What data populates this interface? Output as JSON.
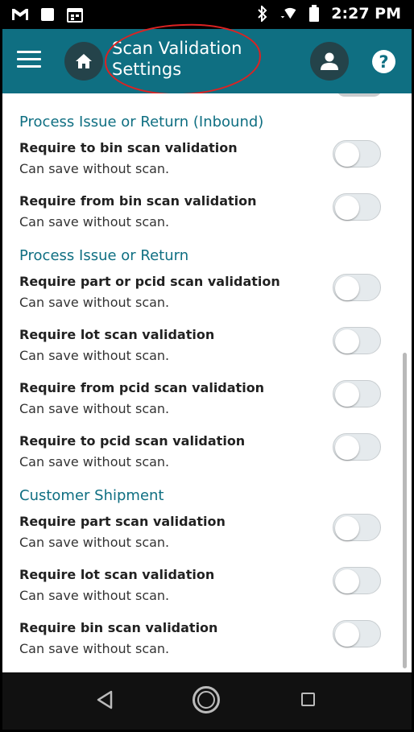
{
  "status_bar": {
    "time": "2:27 PM",
    "icons": [
      "gmail-icon",
      "notification-square-icon",
      "calendar-icon",
      "bluetooth-icon",
      "wifi-icon",
      "battery-icon"
    ]
  },
  "app_bar": {
    "title": "Scan Validation Settings",
    "menu_icon": "hamburger-menu-icon",
    "home_icon": "home-icon",
    "account_icon": "person-icon",
    "help_label": "?"
  },
  "colors": {
    "app_bar": "#0f6f82",
    "section_header": "#0f6f82",
    "annotation": "#dd2222"
  },
  "sections": [
    {
      "title": "Process Issue or Return (Inbound)",
      "settings": [
        {
          "label": "Require to bin scan validation",
          "description": "Can save without scan.",
          "enabled": false
        },
        {
          "label": "Require from bin scan validation",
          "description": "Can save without scan.",
          "enabled": false
        }
      ]
    },
    {
      "title": "Process Issue or Return",
      "settings": [
        {
          "label": "Require part or pcid scan validation",
          "description": "Can save without scan.",
          "enabled": false
        },
        {
          "label": "Require lot scan validation",
          "description": "Can save without scan.",
          "enabled": false
        },
        {
          "label": "Require from pcid scan validation",
          "description": "Can save without scan.",
          "enabled": false
        },
        {
          "label": "Require to pcid scan validation",
          "description": "Can save without scan.",
          "enabled": false
        }
      ]
    },
    {
      "title": "Customer Shipment",
      "settings": [
        {
          "label": "Require part scan validation",
          "description": "Can save without scan.",
          "enabled": false
        },
        {
          "label": "Require lot scan validation",
          "description": "Can save without scan.",
          "enabled": false
        },
        {
          "label": "Require bin scan validation",
          "description": "Can save without scan.",
          "enabled": false
        }
      ]
    }
  ],
  "nav_bar": {
    "icons": [
      "back-triangle-icon",
      "home-circle-icon",
      "recent-apps-square-icon"
    ]
  }
}
